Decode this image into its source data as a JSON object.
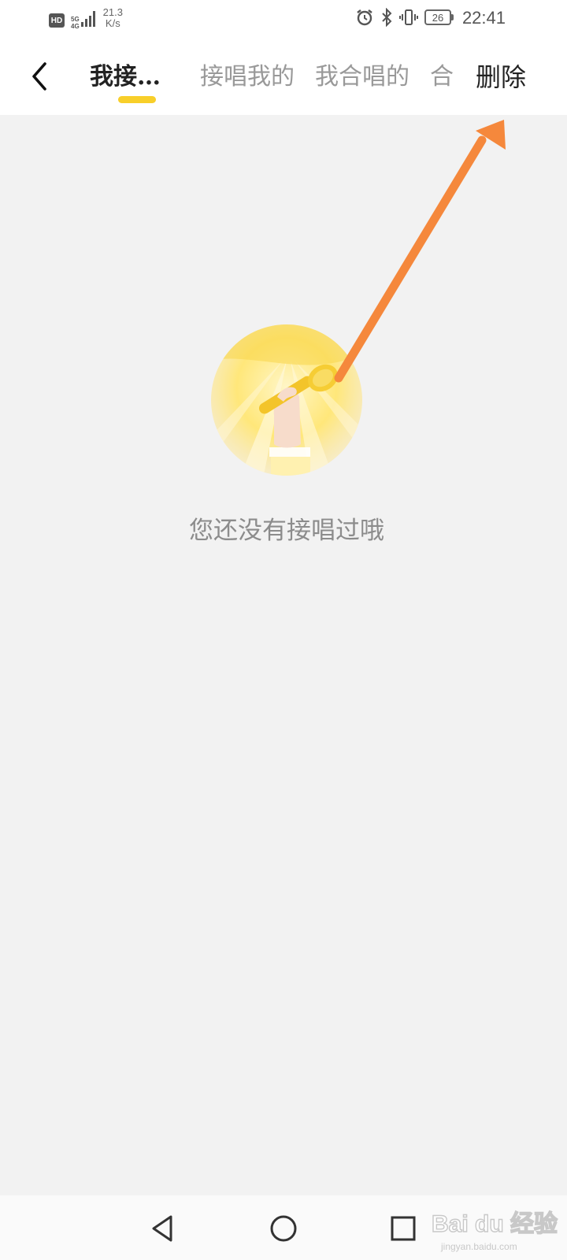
{
  "status_bar": {
    "hd_label": "HD",
    "network_type": "5G",
    "network_sub": "4G",
    "speed_value": "21.3",
    "speed_unit": "K/s",
    "battery_level": "26",
    "time": "22:41",
    "icons": [
      "alarm-icon",
      "bluetooth-icon",
      "vibrate-icon",
      "battery-icon"
    ]
  },
  "header": {
    "back_icon": "chevron-left-icon",
    "tabs": [
      {
        "label": "我接…",
        "active": true
      },
      {
        "label": "接唱我的",
        "active": false
      },
      {
        "label": "我合唱的",
        "active": false
      },
      {
        "label": "合",
        "active": false
      }
    ],
    "delete_label": "删除",
    "accent_color": "#f8cf2a"
  },
  "empty_state": {
    "illustration": "microphone-hand-illustration",
    "message": "您还没有接唱过哦"
  },
  "annotation": {
    "arrow_color": "#f5883c"
  },
  "nav_bar": {
    "icons": [
      "nav-back-icon",
      "nav-home-icon",
      "nav-recent-icon"
    ]
  },
  "watermark": {
    "brand": "Bai du 经验",
    "url": "jingyan.baidu.com"
  }
}
